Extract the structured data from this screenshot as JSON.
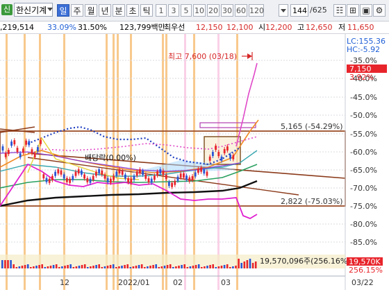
{
  "toolbar": {
    "stock_badge": "신",
    "stock_name": "한신기계",
    "periods": [
      "일",
      "주",
      "월",
      "년",
      "분",
      "초",
      "틱"
    ],
    "active_period": "일",
    "intervals": [
      "1",
      "3",
      "5",
      "10",
      "20",
      "30",
      "60",
      "120"
    ],
    "count_value": "144",
    "count_total": "/625",
    "icons": [
      "indicator-icon",
      "grid-icon",
      "save-icon",
      "settings-icon"
    ]
  },
  "info": {
    "turnover": ",219,514",
    "change_a": "33.09%",
    "change_b": "31.50%",
    "amount": "123,799백만",
    "priority_label": "최우선",
    "ask": "12,150",
    "bid": "12,100",
    "open_label": "시",
    "open": "12,200",
    "high_label": "고",
    "high": "12,650",
    "low_label": "저",
    "low": "11,650"
  },
  "chart": {
    "lc": "LC:155.36",
    "hc": "HC:-5.92",
    "current_value": "7,150",
    "current_pct": "3.92%",
    "high_annotation": "최고 7,600 (03/18)",
    "resistance_label": "5,165 (-54.29%)",
    "support_label": "2,822 (-75.03%)",
    "dividend_label": "배당락(0.00%)",
    "y_ticks": [
      "-35.0%",
      "-40.0%",
      "-45.0%",
      "-50.0%",
      "-55.0%",
      "-60.0%",
      "-65.0%",
      "-70.0%",
      "-75.0%",
      "-80.0%",
      "-85.0%"
    ],
    "x_ticks": [
      "12",
      "2022/01",
      "02",
      "03",
      "03/22"
    ],
    "volume_label": "19,570,096주(256.16%)",
    "volume_value": "19,570K",
    "volume_pct": "256.15%",
    "colors": {
      "up": "#e8242b",
      "down": "#2a55d4",
      "price_box": "#e8242b",
      "resistance": "#a0522d",
      "highlight_band": "#f7c07a"
    }
  }
}
